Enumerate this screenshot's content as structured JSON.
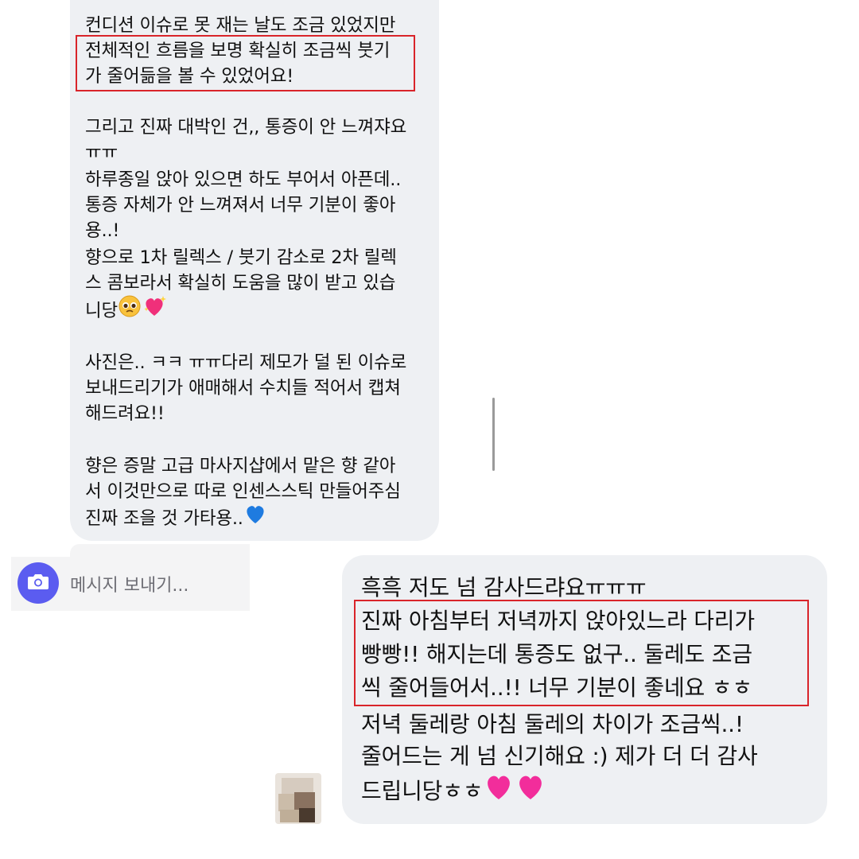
{
  "incoming_message": {
    "lines": [
      "컨디션 이슈로 못 재는 날도 조금 있었지만",
      "전체적인 흐름을 보명 확실히 조금씩 붓기",
      "가 줄어듦을 볼 수 있었어요!",
      "그리고 진짜 대박인 건,, 통증이 안 느껴쟈요",
      "ㅠㅠ",
      "하루종일 앉아 있으면 하도 부어서 아픈데..",
      "통증 자체가 안 느껴져서 너무 기분이 좋아",
      "용..!",
      "향으로 1차 릴렉스 / 붓기 감소로 2차 릴렉",
      "스 콤보라서 확실히 도움을 많이 받고 있습",
      "니당",
      "사진은.. ㅋㅋ ㅠㅠ다리 제모가 덜 된 이슈로",
      "보내드리기가 애매해서 수치들 적어서 캡쳐",
      "해드려요!!",
      "향은 증말 고급 마사지샵에서 맡은 향 같아",
      "서 이것만으로 따로 인센스스틱 만들어주심",
      "진짜 조을 것 가타용.."
    ],
    "emojis": {
      "pleading": "pleading-face",
      "heart": "sparkling-heart",
      "blue_heart": "blue-heart"
    }
  },
  "composer": {
    "placeholder": "메시지 보내기...",
    "camera_icon": "camera-icon"
  },
  "outgoing_message": {
    "lines": [
      "흑흑 저도 넘 감사드랴요ㅠㅠㅠ",
      "진짜 아침부터 저녁까지 앉아있느라 다리가",
      "빵빵!! 해지는데 통증도 없구.. 둘레도 조금",
      "씩 줄어들어서..!! 너무 기분이 좋네요 ㅎㅎ",
      "저녁 둘레랑 아침 둘레의 차이가 조금씩..!",
      "줄어드는 게 넘 신기해요 :) 제가 더 더 감사",
      "드립니당ㅎㅎ"
    ],
    "emojis": {
      "heart": "pink-heart"
    }
  },
  "colors": {
    "bubble": "#eef0f3",
    "highlight": "#d9242a",
    "camera_button": "#5b5cf0"
  }
}
